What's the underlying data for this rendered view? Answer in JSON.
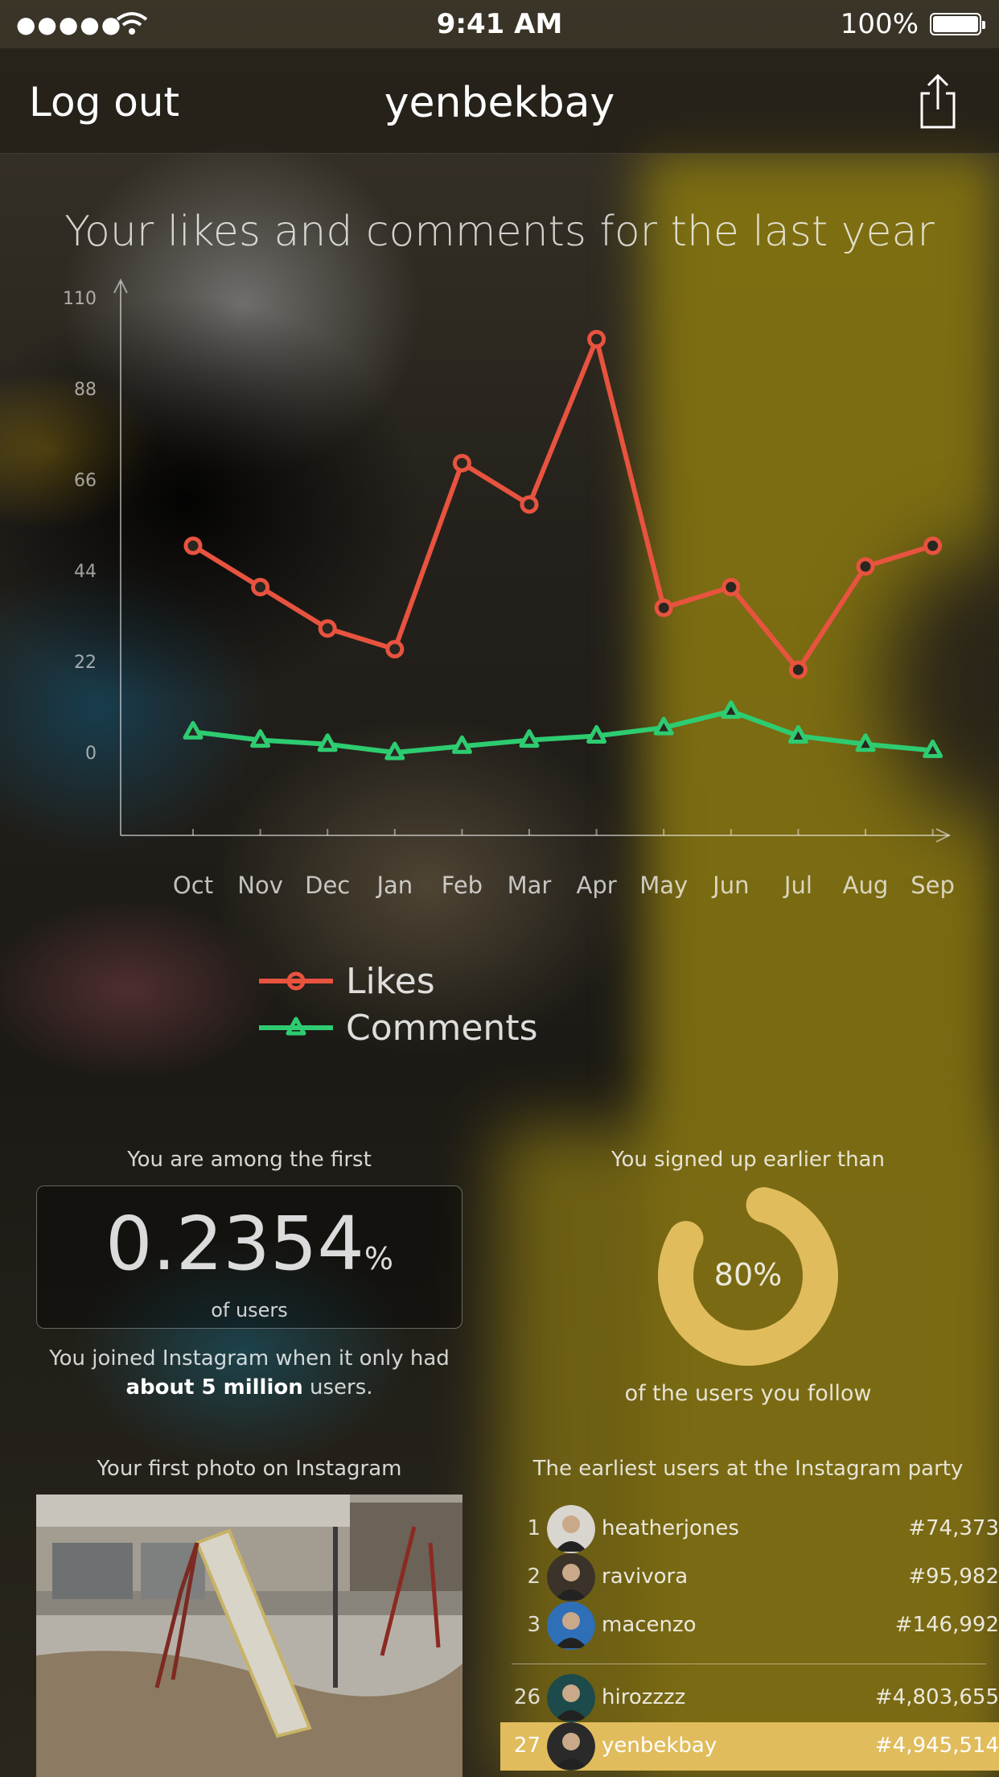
{
  "status_bar": {
    "signal": "●●●●●",
    "time": "9:41 AM",
    "battery": "100%"
  },
  "nav": {
    "logout": "Log out",
    "title": "yenbekbay"
  },
  "chart_title": "Your likes and comments for the last year",
  "chart_data": {
    "type": "line",
    "categories": [
      "Oct",
      "Nov",
      "Dec",
      "Jan",
      "Feb",
      "Mar",
      "Apr",
      "May",
      "Jun",
      "Jul",
      "Aug",
      "Sep"
    ],
    "series": [
      {
        "name": "Likes",
        "color": "#e8533f",
        "marker": "circle",
        "values": [
          50,
          40,
          30,
          25,
          70,
          60,
          100,
          35,
          40,
          20,
          45,
          50
        ]
      },
      {
        "name": "Comments",
        "color": "#2ecc71",
        "marker": "triangle",
        "values": [
          5,
          3,
          2,
          0,
          1.5,
          3,
          4,
          6,
          10,
          4,
          2,
          0.5
        ]
      }
    ],
    "yticks": [
      0,
      22,
      44,
      66,
      88,
      110
    ],
    "ylim": [
      0,
      110
    ],
    "grid": false
  },
  "stats": {
    "among_label": "You are among the first",
    "among_value": "0.2354",
    "among_unit": "%",
    "among_sub": "of users",
    "joined_pre": "You joined Instagram when it only had ",
    "joined_bold": "about 5 million",
    "joined_post": " users.",
    "signed_label": "You signed up earlier than",
    "signed_value": "80%",
    "signed_fraction": 0.8,
    "signed_sub": "of the users you follow",
    "donut_color": "#e1bc5c"
  },
  "first_photo_label": "Your first photo on Instagram",
  "earliest": {
    "label": "The earliest users at the Instagram party",
    "top": [
      {
        "rank": "1",
        "name": "heatherjones",
        "num": "#74,373"
      },
      {
        "rank": "2",
        "name": "ravivora",
        "num": "#95,982"
      },
      {
        "rank": "3",
        "name": "macenzo",
        "num": "#146,992"
      }
    ],
    "nearby": [
      {
        "rank": "26",
        "name": "hirozzzz",
        "num": "#4,803,655"
      },
      {
        "rank": "27",
        "name": "yenbekbay",
        "num": "#4,945,514"
      }
    ]
  }
}
